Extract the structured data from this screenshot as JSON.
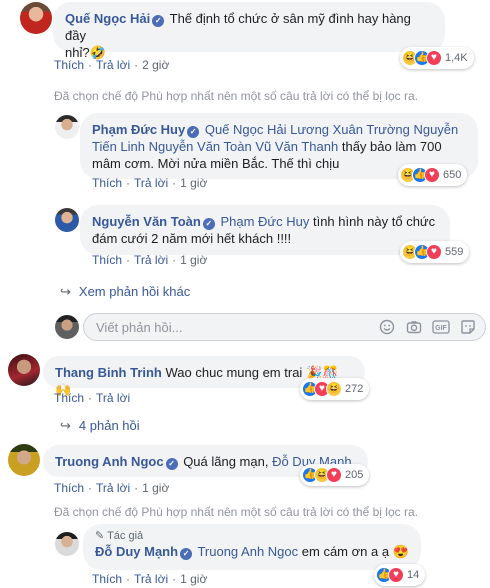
{
  "comments": [
    {
      "author": "Quế Ngọc Hải",
      "text_line1": "Thế định tổ chức ở sân mỹ đình hay hàng đầy",
      "text_line2": "nhỉ?",
      "emoji": "🤣",
      "reactions": [
        "haha",
        "like",
        "love"
      ],
      "reaction_count": "1,4K",
      "like_label": "Thích",
      "reply_label": "Trả lời",
      "time": "2 giờ"
    },
    {
      "author": "Phạm Đức Huy",
      "tags_line1": "Quế Ngọc Hải Lương Xuân Trường Nguyễn",
      "tags_line2": "Tiến Linh Nguyễn Văn Toàn Vũ Văn Thanh",
      "text_after_tags": " thấy bảo làm 700",
      "text_line3": "mâm cơm. Mời nửa miền Bắc. Thế thì chịu",
      "reactions": [
        "haha",
        "like",
        "love"
      ],
      "reaction_count": "650",
      "like_label": "Thích",
      "reply_label": "Trả lời",
      "time": "1 giờ"
    },
    {
      "author": "Nguyễn Văn Toàn",
      "tag": "Phạm Đức Huy",
      "text_line1": " tình hình này tổ chức",
      "text_line2": "đám cưới 2 năm mới hết khách !!!!",
      "reactions": [
        "haha",
        "like",
        "love"
      ],
      "reaction_count": "559",
      "like_label": "Thích",
      "reply_label": "Trả lời",
      "time": "1 giờ"
    },
    {
      "author": "Thang Binh Trinh",
      "text": "Wao chuc mung em trai",
      "emoji": "🎉🎊🙌",
      "reactions": [
        "like",
        "love",
        "haha"
      ],
      "reaction_count": "272",
      "like_label": "Thích",
      "reply_label": "Trả lời"
    },
    {
      "author": "Truong Anh Ngoc",
      "text": "Quá lãng mạn, ",
      "tag": "Đỗ Duy Mạnh",
      "reactions": [
        "like",
        "haha",
        "love"
      ],
      "reaction_count": "205",
      "like_label": "Thích",
      "reply_label": "Trả lời",
      "time": "1 giờ"
    },
    {
      "badge": "Tác giả",
      "author": "Đỗ Duy Mạnh",
      "tag": "Truong Anh Ngoc",
      "text": " em cám ơn a ạ",
      "emoji": "😍",
      "reactions": [
        "like",
        "love"
      ],
      "reaction_count": "14",
      "like_label": "Thích",
      "reply_label": "Trả lời",
      "time": "1 giờ"
    }
  ],
  "filter_notice": "Đã chọn chế độ Phù hợp nhất nên một số câu trả lời có thể bị lọc ra.",
  "more_replies": "Xem phản hồi khác",
  "reply_count": "4 phản hồi",
  "reply_input": {
    "placeholder": "Viết phản hồi..."
  },
  "reply_icons": [
    "emoji-icon",
    "camera-icon",
    "gif-icon",
    "sticker-icon"
  ],
  "colors": {
    "link": "#385898",
    "bubble": "#f2f3f5",
    "meta": "#606770"
  }
}
